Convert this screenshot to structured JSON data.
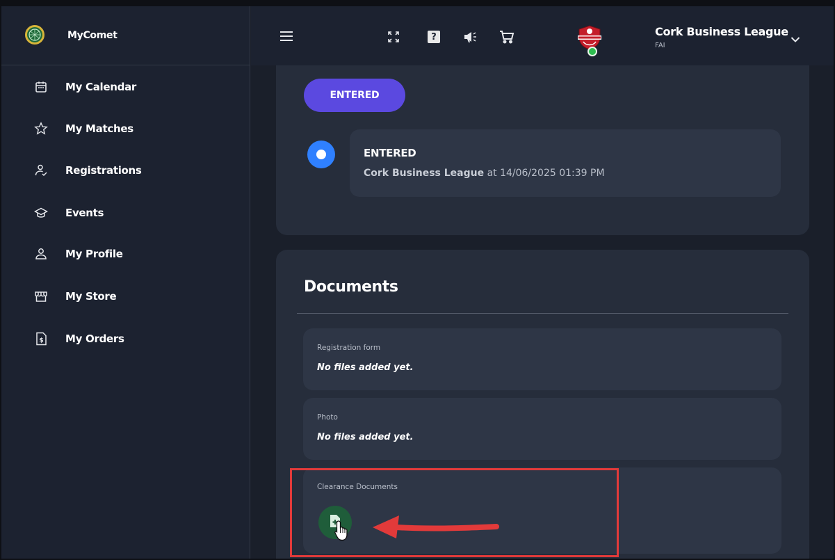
{
  "app": {
    "name": "MyComet"
  },
  "sidebar": {
    "items": [
      {
        "label": "My Calendar",
        "icon": "calendar-icon"
      },
      {
        "label": "My Matches",
        "icon": "star-icon"
      },
      {
        "label": "Registrations",
        "icon": "user-check-icon"
      },
      {
        "label": "Events",
        "icon": "graduation-cap-icon"
      },
      {
        "label": "My Profile",
        "icon": "user-icon"
      },
      {
        "label": "My Store",
        "icon": "store-icon"
      },
      {
        "label": "My Orders",
        "icon": "invoice-icon"
      }
    ]
  },
  "topbar": {
    "icons": [
      "menu-icon",
      "fullscreen-icon",
      "help-icon",
      "megaphone-icon",
      "cart-icon"
    ],
    "help_glyph": "?",
    "org_name": "Cork Business League",
    "org_sub": "FAI"
  },
  "status": {
    "pill_label": "ENTERED",
    "event_title": "ENTERED",
    "event_org": "Cork Business League",
    "event_time": "at 14/06/2025 01:39 PM"
  },
  "documents": {
    "title": "Documents",
    "items": [
      {
        "label": "Registration form",
        "value": "No files added yet."
      },
      {
        "label": "Photo",
        "value": "No files added yet."
      },
      {
        "label": "Clearance Documents",
        "value": ""
      }
    ]
  },
  "colors": {
    "accent": "#5b49e0",
    "timeline": "#2f80ff",
    "add_button": "#1f5d3a",
    "annotation": "#e23a3a"
  }
}
